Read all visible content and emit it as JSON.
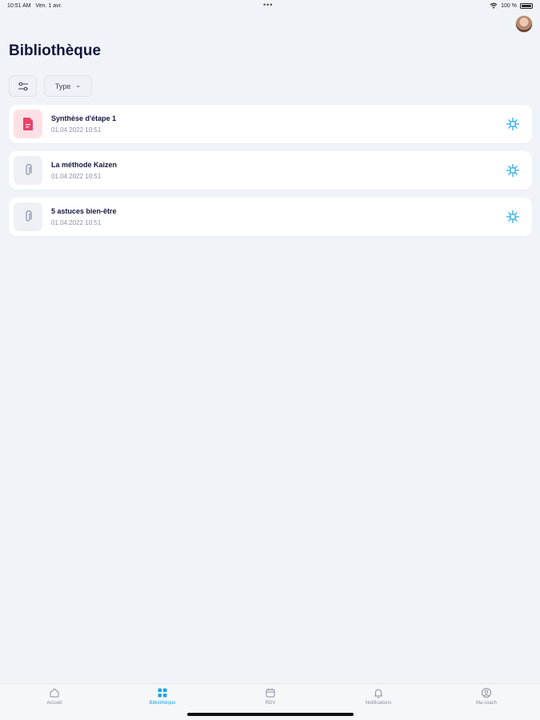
{
  "status_bar": {
    "time": "10:51 AM",
    "date": "Ven. 1 avr.",
    "dots": "•••",
    "battery_text": "100 %"
  },
  "header": {
    "title": "Bibliothèque"
  },
  "filters": {
    "type_label": "Type"
  },
  "items": [
    {
      "title": "Synthèse d'étape 1",
      "date": "01.04.2022 10:51",
      "icon": "document-icon",
      "accent": "#e8436a"
    },
    {
      "title": "La méthode Kaizen",
      "date": "01.04.2022 10:51",
      "icon": "paperclip-icon"
    },
    {
      "title": "5 astuces bien-être",
      "date": "01.04.2022 10:51",
      "icon": "paperclip-icon"
    }
  ],
  "tabbar": {
    "tabs": [
      {
        "label": "Accueil",
        "icon": "home-icon"
      },
      {
        "label": "Bibliothèque",
        "icon": "grid-icon",
        "active": true
      },
      {
        "label": "RDV",
        "icon": "calendar-icon"
      },
      {
        "label": "Notifications",
        "icon": "bell-icon"
      },
      {
        "label": "Ma coach",
        "icon": "coach-icon"
      }
    ]
  },
  "colors": {
    "accent": "#1aa6e6",
    "background": "#f0f4f8",
    "title": "#15163f"
  }
}
